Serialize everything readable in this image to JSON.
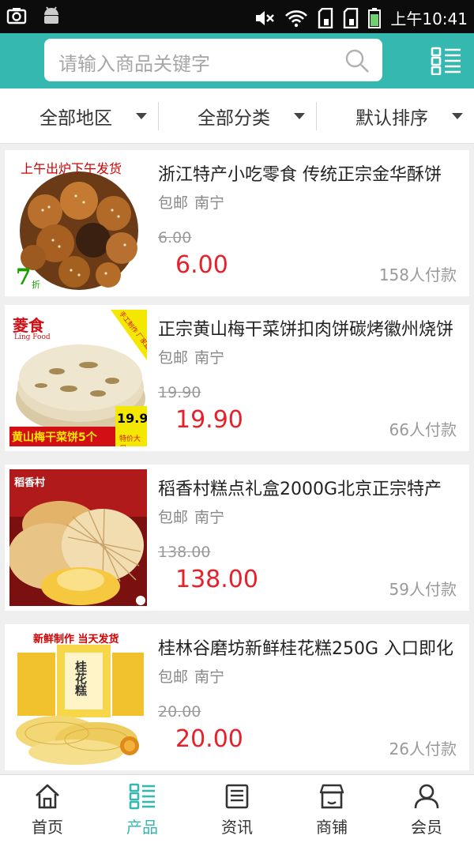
{
  "status_bar": {
    "time": "上午10:41"
  },
  "search": {
    "placeholder": "请输入商品关键字"
  },
  "filters": [
    {
      "label": "全部地区"
    },
    {
      "label": "全部分类"
    },
    {
      "label": "默认排序"
    }
  ],
  "products": [
    {
      "title": "浙江特产小吃零食 传统正宗金华酥饼",
      "shipping": "包邮",
      "location": "南宁",
      "original_price": "6.00",
      "price": "6.00",
      "sold": "158人付款",
      "image_text": {
        "banner": "上午出炉下午发货",
        "discount": "7",
        "discount_unit": "折"
      }
    },
    {
      "title": "正宗黄山梅干菜饼扣肉饼碳烤徽州烧饼",
      "shipping": "包邮",
      "location": "南宁",
      "original_price": "19.90",
      "price": "19.90",
      "sold": "66人付款",
      "image_text": {
        "brand": "菱食",
        "brand_en": "Ling Food",
        "corner": "手工制作 厂家直销",
        "caption": "黄山梅干菜饼5个",
        "price_tag": "19.9",
        "promo": "特价大促"
      }
    },
    {
      "title": "稻香村糕点礼盒2000G北京正宗特产",
      "shipping": "包邮",
      "location": "南宁",
      "original_price": "138.00",
      "price": "138.00",
      "sold": "59人付款",
      "image_text": {
        "brand": "稻香村"
      }
    },
    {
      "title": "桂林谷磨坊新鲜桂花糕250G 入口即化",
      "shipping": "包邮",
      "location": "南宁",
      "original_price": "20.00",
      "price": "20.00",
      "sold": "26人付款",
      "image_text": {
        "banner": "新鲜制作 当天发货",
        "box": "桂花糕"
      }
    }
  ],
  "tabs": [
    {
      "label": "首页",
      "icon": "home-icon"
    },
    {
      "label": "产品",
      "icon": "product-list-icon",
      "active": true
    },
    {
      "label": "资讯",
      "icon": "news-icon"
    },
    {
      "label": "商铺",
      "icon": "shop-icon"
    },
    {
      "label": "会员",
      "icon": "member-icon"
    }
  ],
  "colors": {
    "accent": "#34b8b0",
    "price": "#e8202a",
    "status_bar": "#0c0c0c"
  }
}
